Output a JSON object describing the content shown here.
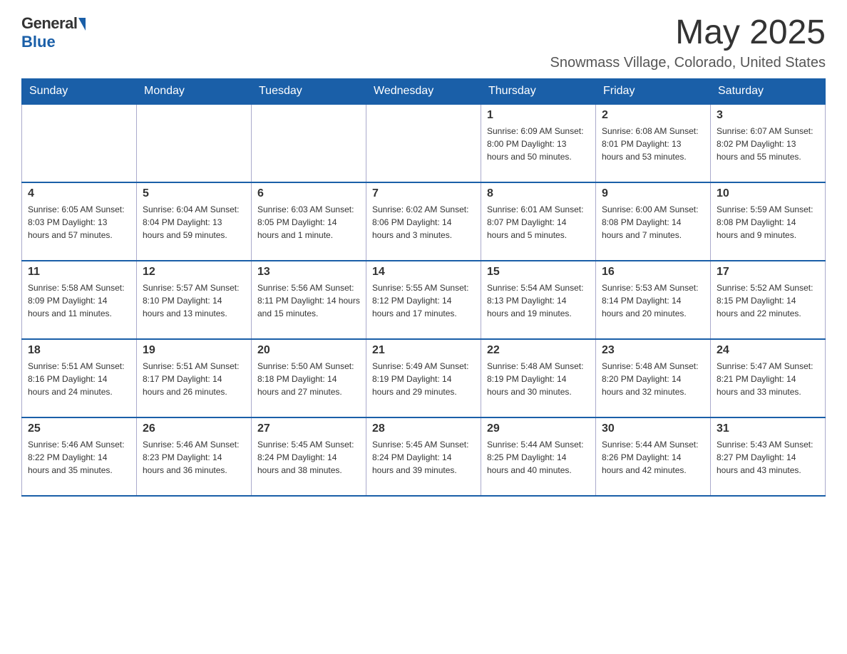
{
  "logo": {
    "general": "General",
    "blue": "Blue"
  },
  "title": {
    "month_year": "May 2025",
    "location": "Snowmass Village, Colorado, United States"
  },
  "days_of_week": [
    "Sunday",
    "Monday",
    "Tuesday",
    "Wednesday",
    "Thursday",
    "Friday",
    "Saturday"
  ],
  "weeks": [
    [
      {
        "day": "",
        "info": ""
      },
      {
        "day": "",
        "info": ""
      },
      {
        "day": "",
        "info": ""
      },
      {
        "day": "",
        "info": ""
      },
      {
        "day": "1",
        "info": "Sunrise: 6:09 AM\nSunset: 8:00 PM\nDaylight: 13 hours and 50 minutes."
      },
      {
        "day": "2",
        "info": "Sunrise: 6:08 AM\nSunset: 8:01 PM\nDaylight: 13 hours and 53 minutes."
      },
      {
        "day": "3",
        "info": "Sunrise: 6:07 AM\nSunset: 8:02 PM\nDaylight: 13 hours and 55 minutes."
      }
    ],
    [
      {
        "day": "4",
        "info": "Sunrise: 6:05 AM\nSunset: 8:03 PM\nDaylight: 13 hours and 57 minutes."
      },
      {
        "day": "5",
        "info": "Sunrise: 6:04 AM\nSunset: 8:04 PM\nDaylight: 13 hours and 59 minutes."
      },
      {
        "day": "6",
        "info": "Sunrise: 6:03 AM\nSunset: 8:05 PM\nDaylight: 14 hours and 1 minute."
      },
      {
        "day": "7",
        "info": "Sunrise: 6:02 AM\nSunset: 8:06 PM\nDaylight: 14 hours and 3 minutes."
      },
      {
        "day": "8",
        "info": "Sunrise: 6:01 AM\nSunset: 8:07 PM\nDaylight: 14 hours and 5 minutes."
      },
      {
        "day": "9",
        "info": "Sunrise: 6:00 AM\nSunset: 8:08 PM\nDaylight: 14 hours and 7 minutes."
      },
      {
        "day": "10",
        "info": "Sunrise: 5:59 AM\nSunset: 8:08 PM\nDaylight: 14 hours and 9 minutes."
      }
    ],
    [
      {
        "day": "11",
        "info": "Sunrise: 5:58 AM\nSunset: 8:09 PM\nDaylight: 14 hours and 11 minutes."
      },
      {
        "day": "12",
        "info": "Sunrise: 5:57 AM\nSunset: 8:10 PM\nDaylight: 14 hours and 13 minutes."
      },
      {
        "day": "13",
        "info": "Sunrise: 5:56 AM\nSunset: 8:11 PM\nDaylight: 14 hours and 15 minutes."
      },
      {
        "day": "14",
        "info": "Sunrise: 5:55 AM\nSunset: 8:12 PM\nDaylight: 14 hours and 17 minutes."
      },
      {
        "day": "15",
        "info": "Sunrise: 5:54 AM\nSunset: 8:13 PM\nDaylight: 14 hours and 19 minutes."
      },
      {
        "day": "16",
        "info": "Sunrise: 5:53 AM\nSunset: 8:14 PM\nDaylight: 14 hours and 20 minutes."
      },
      {
        "day": "17",
        "info": "Sunrise: 5:52 AM\nSunset: 8:15 PM\nDaylight: 14 hours and 22 minutes."
      }
    ],
    [
      {
        "day": "18",
        "info": "Sunrise: 5:51 AM\nSunset: 8:16 PM\nDaylight: 14 hours and 24 minutes."
      },
      {
        "day": "19",
        "info": "Sunrise: 5:51 AM\nSunset: 8:17 PM\nDaylight: 14 hours and 26 minutes."
      },
      {
        "day": "20",
        "info": "Sunrise: 5:50 AM\nSunset: 8:18 PM\nDaylight: 14 hours and 27 minutes."
      },
      {
        "day": "21",
        "info": "Sunrise: 5:49 AM\nSunset: 8:19 PM\nDaylight: 14 hours and 29 minutes."
      },
      {
        "day": "22",
        "info": "Sunrise: 5:48 AM\nSunset: 8:19 PM\nDaylight: 14 hours and 30 minutes."
      },
      {
        "day": "23",
        "info": "Sunrise: 5:48 AM\nSunset: 8:20 PM\nDaylight: 14 hours and 32 minutes."
      },
      {
        "day": "24",
        "info": "Sunrise: 5:47 AM\nSunset: 8:21 PM\nDaylight: 14 hours and 33 minutes."
      }
    ],
    [
      {
        "day": "25",
        "info": "Sunrise: 5:46 AM\nSunset: 8:22 PM\nDaylight: 14 hours and 35 minutes."
      },
      {
        "day": "26",
        "info": "Sunrise: 5:46 AM\nSunset: 8:23 PM\nDaylight: 14 hours and 36 minutes."
      },
      {
        "day": "27",
        "info": "Sunrise: 5:45 AM\nSunset: 8:24 PM\nDaylight: 14 hours and 38 minutes."
      },
      {
        "day": "28",
        "info": "Sunrise: 5:45 AM\nSunset: 8:24 PM\nDaylight: 14 hours and 39 minutes."
      },
      {
        "day": "29",
        "info": "Sunrise: 5:44 AM\nSunset: 8:25 PM\nDaylight: 14 hours and 40 minutes."
      },
      {
        "day": "30",
        "info": "Sunrise: 5:44 AM\nSunset: 8:26 PM\nDaylight: 14 hours and 42 minutes."
      },
      {
        "day": "31",
        "info": "Sunrise: 5:43 AM\nSunset: 8:27 PM\nDaylight: 14 hours and 43 minutes."
      }
    ]
  ]
}
